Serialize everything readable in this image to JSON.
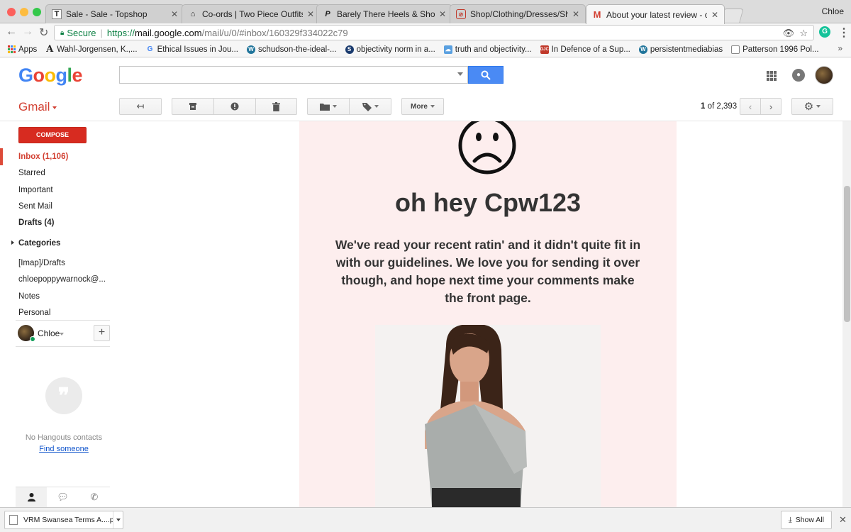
{
  "browser": {
    "profile_name": "Chloe",
    "tabs": [
      {
        "title": "Sale - Sale - Topshop",
        "favicon": "T",
        "active": false
      },
      {
        "title": "Co-ords | Two Piece Outfits & ",
        "favicon": "hanger-icon",
        "active": false
      },
      {
        "title": "Barely There Heels & Shoes | P",
        "favicon": "p-logo-icon",
        "active": false
      },
      {
        "title": "Shop/Clothing/Dresses/Shop c",
        "favicon": "shop-icon",
        "active": false
      },
      {
        "title": "About your latest review - chlo",
        "favicon": "gmail-m-icon",
        "active": true
      }
    ],
    "address": {
      "secure_label": "Secure",
      "scheme": "https://",
      "host": "mail.google.com",
      "path": "/mail/u/0/#inbox/160329f334022c79"
    },
    "bookmarks": [
      {
        "label": "Apps",
        "icon": "apps-grid-icon"
      },
      {
        "label": "Wahl-Jorgensen, K.,...",
        "icon": "A"
      },
      {
        "label": "Ethical Issues in Jou...",
        "icon": "G"
      },
      {
        "label": "schudson-the-ideal-...",
        "icon": "wordpress-icon"
      },
      {
        "label": "objectivity norm in a...",
        "icon": "S"
      },
      {
        "label": "truth and objectivity...",
        "icon": "cloud-icon"
      },
      {
        "label": "In Defence of a Sup...",
        "icon": "OJC"
      },
      {
        "label": "persistentmediabias",
        "icon": "wordpress-icon"
      },
      {
        "label": "Patterson 1996 Pol...",
        "icon": "page-icon"
      }
    ],
    "bookmarks_more": "»",
    "download": {
      "filename": "VRM Swansea Terms A....pdf",
      "show_all": "Show All",
      "close": "✕"
    }
  },
  "gmail": {
    "logo": [
      "G",
      "o",
      "o",
      "g",
      "l",
      "e"
    ],
    "logo_colors": [
      "#4285f4",
      "#ea4335",
      "#fbbc05",
      "#4285f4",
      "#34a853",
      "#ea4335"
    ],
    "label": "Gmail",
    "toolbar": {
      "more_label": "More",
      "page_current": "1",
      "page_of": "of 2,393"
    },
    "compose": "COMPOSE",
    "nav": [
      {
        "label": "Inbox (1,106)",
        "style": "active"
      },
      {
        "label": "Starred",
        "style": ""
      },
      {
        "label": "Important",
        "style": ""
      },
      {
        "label": "Sent Mail",
        "style": ""
      },
      {
        "label": "Drafts (4)",
        "style": "bold"
      },
      {
        "label": "Categories",
        "style": "bold"
      },
      {
        "label": "[Imap]/Drafts",
        "style": ""
      },
      {
        "label": "chloepoppywarnock@...",
        "style": ""
      },
      {
        "label": "Notes",
        "style": ""
      },
      {
        "label": "Personal",
        "style": ""
      }
    ],
    "hangouts": {
      "user": "Chloe",
      "add": "+",
      "empty_text": "No Hangouts contacts",
      "find_link": "Find someone"
    },
    "accent": "#d23f31",
    "search_btn_color": "#4a8af4"
  },
  "email": {
    "heading": "oh hey Cpw123",
    "body": "We've read your recent ratin' and it didn't quite fit in with our guidelines. We love you for sending it over though, and hope next time your comments make the front page.",
    "background": "#fdeeee"
  }
}
